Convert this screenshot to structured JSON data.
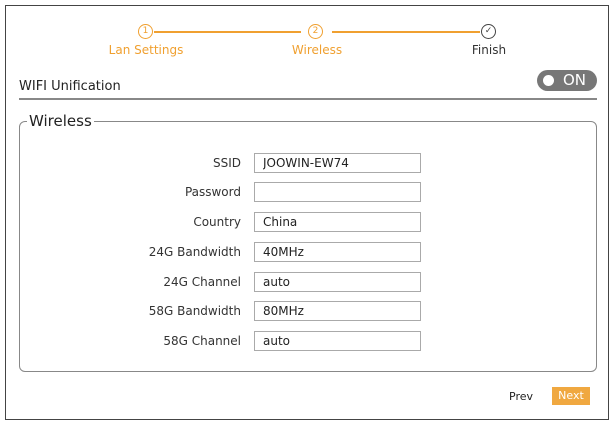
{
  "steps": [
    {
      "num": "1",
      "label": "Lan Settings"
    },
    {
      "num": "2",
      "label": "Wireless"
    },
    {
      "num": "✓",
      "label": "Finish"
    }
  ],
  "section_title": "WIFI Unification",
  "toggle": {
    "label": "ON",
    "state": true
  },
  "wireless": {
    "legend": "Wireless",
    "fields": [
      {
        "label": "SSID",
        "value": "JOOWIN-EW74"
      },
      {
        "label": "Password",
        "value": ""
      },
      {
        "label": "Country",
        "value": "China"
      },
      {
        "label": "24G Bandwidth",
        "value": "40MHz"
      },
      {
        "label": "24G Channel",
        "value": "auto"
      },
      {
        "label": "58G Bandwidth",
        "value": "80MHz"
      },
      {
        "label": "58G Channel",
        "value": "auto"
      }
    ]
  },
  "buttons": {
    "prev": "Prev",
    "next": "Next"
  }
}
